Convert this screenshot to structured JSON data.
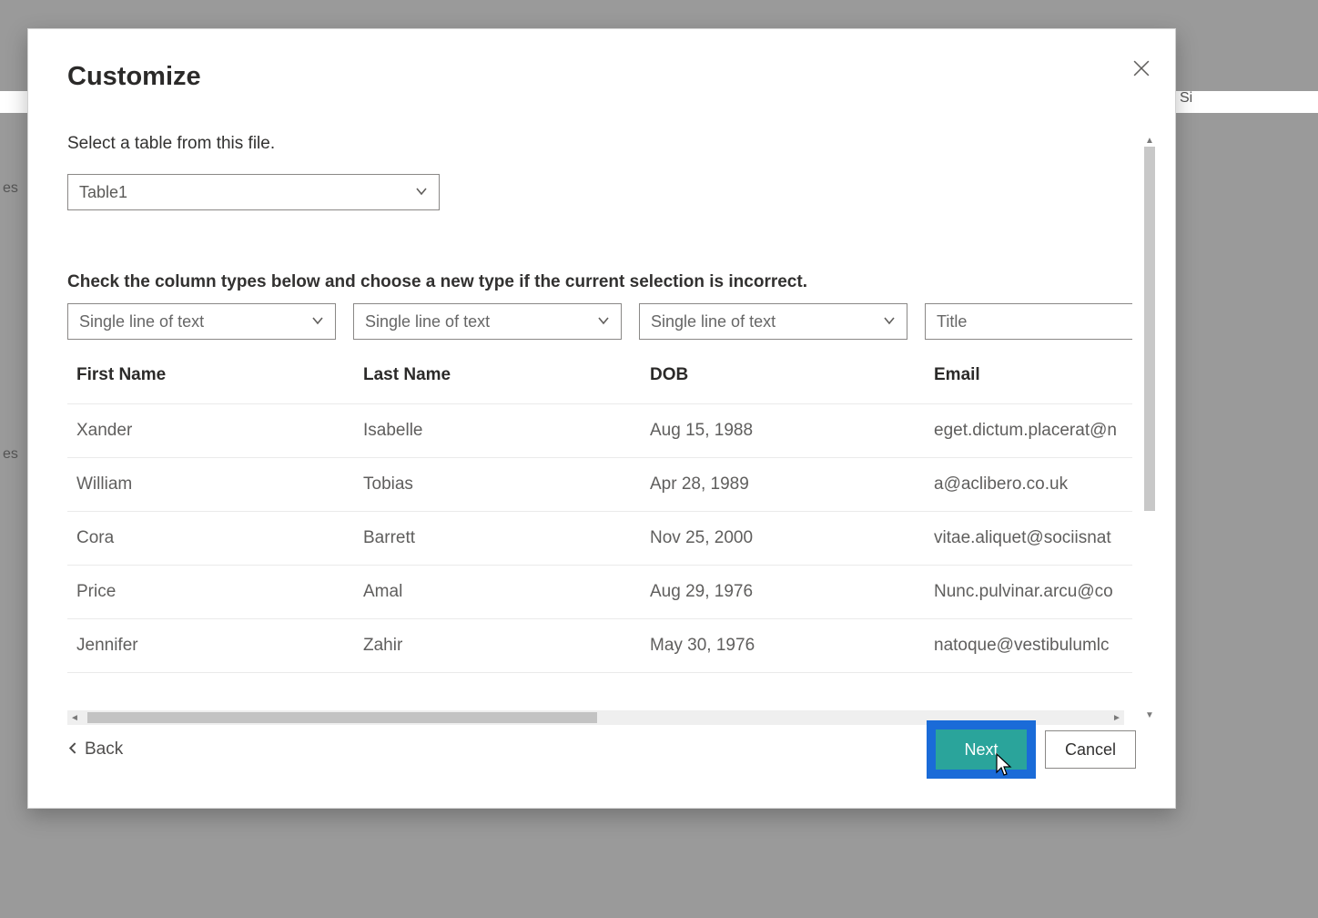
{
  "background": {
    "sidebar_hint_1": "es",
    "sidebar_hint_2": "es",
    "right_hint": "Si"
  },
  "modal": {
    "title": "Customize",
    "select_table_label": "Select a table from this file.",
    "table_selector_value": "Table1",
    "column_types_label": "Check the column types below and choose a new type if the current selection is incorrect.",
    "column_types": {
      "0": "Single line of text",
      "1": "Single line of text",
      "2": "Single line of text",
      "3": "Title"
    },
    "columns": {
      "0": "First Name",
      "1": "Last Name",
      "2": "DOB",
      "3": "Email"
    },
    "rows": [
      {
        "first": "Xander",
        "last": "Isabelle",
        "dob": "Aug 15, 1988",
        "email": "eget.dictum.placerat@n"
      },
      {
        "first": "William",
        "last": "Tobias",
        "dob": "Apr 28, 1989",
        "email": "a@aclibero.co.uk"
      },
      {
        "first": "Cora",
        "last": "Barrett",
        "dob": "Nov 25, 2000",
        "email": "vitae.aliquet@sociisnat"
      },
      {
        "first": "Price",
        "last": "Amal",
        "dob": "Aug 29, 1976",
        "email": "Nunc.pulvinar.arcu@co"
      },
      {
        "first": "Jennifer",
        "last": "Zahir",
        "dob": "May 30, 1976",
        "email": "natoque@vestibulumlc"
      }
    ],
    "footer": {
      "back": "Back",
      "next": "Next",
      "cancel": "Cancel"
    }
  }
}
